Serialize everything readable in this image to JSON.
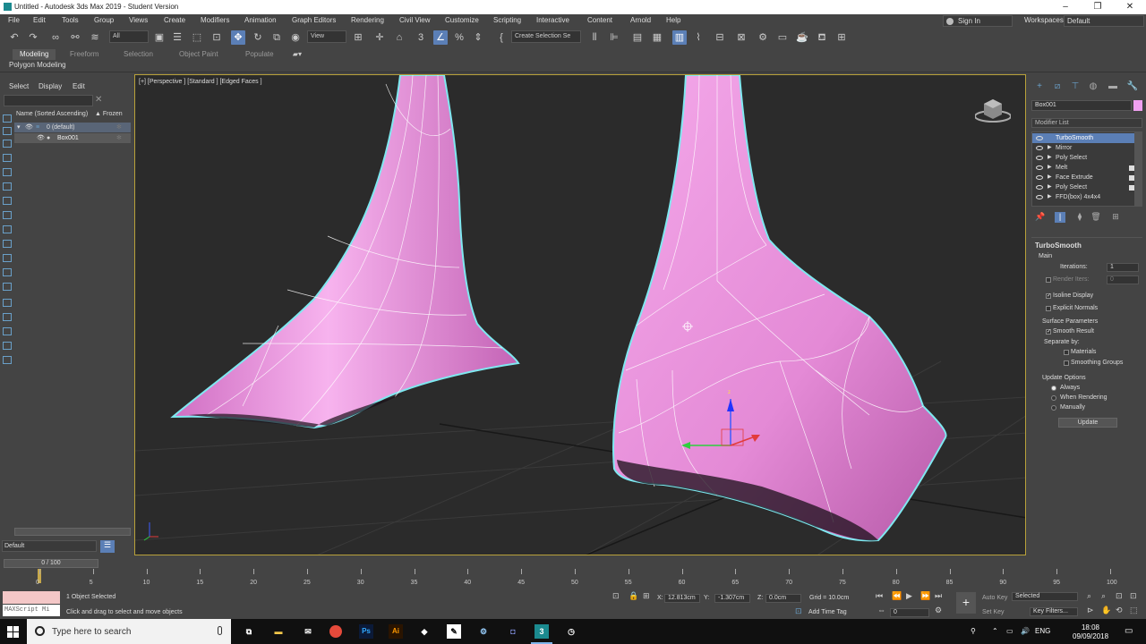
{
  "window": {
    "title": "Untitled - Autodesk 3ds Max 2019 - Student Version",
    "minimize": "–",
    "maximize": "❐",
    "close": "✕"
  },
  "menubar": {
    "items": [
      "File",
      "Edit",
      "Tools",
      "Group",
      "Views",
      "Create",
      "Modifiers",
      "Animation",
      "Graph Editors",
      "Rendering",
      "Civil View",
      "Customize",
      "Scripting",
      "Interactive",
      "Content",
      "Arnold",
      "Help"
    ],
    "sign_in": "Sign In",
    "workspaces_label": "Workspaces:",
    "workspace_value": "Default"
  },
  "toolbar": {
    "selection_filter": "All",
    "ref_coord": "View",
    "named_selection": "Create Selection Se"
  },
  "ribbon": {
    "tabs": [
      "Modeling",
      "Freeform",
      "Selection",
      "Object Paint",
      "Populate"
    ],
    "active_tab": "Modeling",
    "sub_label": "Polygon Modeling"
  },
  "explorer": {
    "menus": [
      "Select",
      "Display",
      "Edit"
    ],
    "header_name": "Name (Sorted Ascending)",
    "header_frozen": "▲ Frozen",
    "rows": [
      {
        "label": "0 (default)"
      },
      {
        "label": "Box001"
      }
    ],
    "layer": "Default"
  },
  "viewport": {
    "label": "[+] [Perspective ] [Standard ] [Edged Faces ]",
    "mesh_color": "#f29ae6",
    "selection_color": "#7fe8f0"
  },
  "command_panel": {
    "object_name": "Box001",
    "object_color": "#f0a0f0",
    "modifier_list": "Modifier List",
    "stack": [
      {
        "label": "TurboSmooth",
        "selected": true,
        "box": false
      },
      {
        "label": "Mirror",
        "selected": false,
        "box": false
      },
      {
        "label": "Poly Select",
        "selected": false,
        "box": false
      },
      {
        "label": "Melt",
        "selected": false,
        "box": true
      },
      {
        "label": "Face Extrude",
        "selected": false,
        "box": true
      },
      {
        "label": "Poly Select",
        "selected": false,
        "box": true
      },
      {
        "label": "FFD(box) 4x4x4",
        "selected": false,
        "box": false
      }
    ],
    "rollout": {
      "title": "TurboSmooth",
      "main": "Main",
      "iterations_label": "Iterations:",
      "iterations_value": "1",
      "render_iters_label": "Render Iters:",
      "render_iters_value": "0",
      "isoline_display": "Isoline Display",
      "explicit_normals": "Explicit Normals",
      "surface_params": "Surface Parameters",
      "smooth_result": "Smooth Result",
      "separate_by": "Separate by:",
      "materials": "Materials",
      "smoothing_groups": "Smoothing Groups",
      "update_options": "Update Options",
      "always": "Always",
      "when_rendering": "When Rendering",
      "manually": "Manually",
      "update_button": "Update"
    }
  },
  "timeline": {
    "frame": "0 / 100",
    "ticks": [
      0,
      5,
      10,
      15,
      20,
      25,
      30,
      35,
      40,
      45,
      50,
      55,
      60,
      65,
      70,
      75,
      80,
      85,
      90,
      95,
      100
    ]
  },
  "status": {
    "maxscript": "MAXScript Mi",
    "selected": "1 Object Selected",
    "prompt": "Click and drag to select and move objects",
    "x_label": "X:",
    "x_value": "12.813cm",
    "y_label": "Y:",
    "y_value": "-1.307cm",
    "z_label": "Z:",
    "z_value": "0.0cm",
    "grid": "Grid = 10.0cm",
    "add_time_tag": "Add Time Tag",
    "auto_key": "Auto Key",
    "set_key": "Set Key",
    "key_mode": "Selected",
    "key_filters": "Key Filters...",
    "current_frame": "0"
  },
  "taskbar": {
    "search_placeholder": "Type here to search",
    "time": "18:08",
    "date": "09/09/2018",
    "lang": "ENG"
  }
}
